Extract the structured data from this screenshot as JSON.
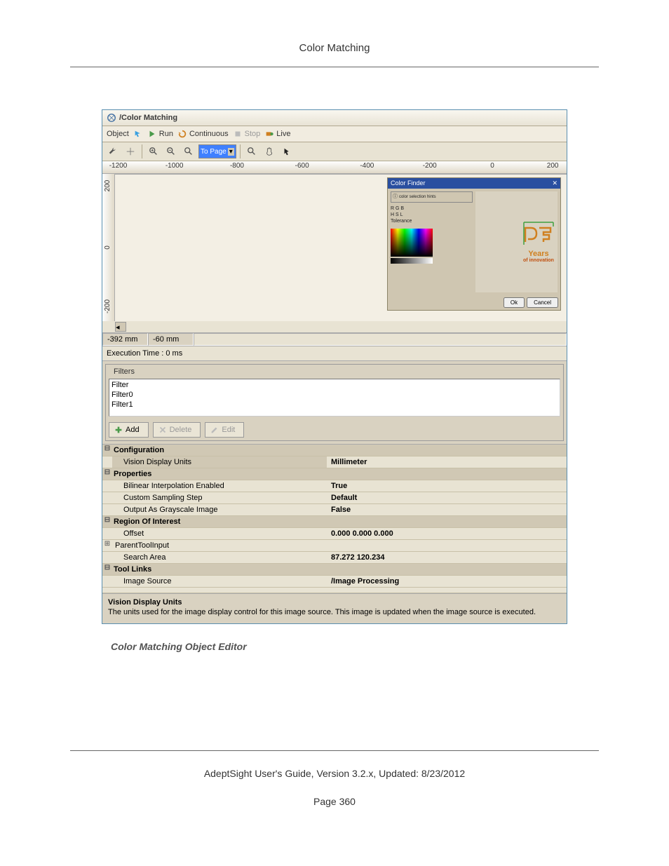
{
  "page": {
    "header": "Color Matching",
    "caption": "Color Matching Object Editor",
    "footer_text": "AdeptSight User's Guide,  Version 3.2.x, Updated: 8/23/2012",
    "page_number": "Page 360"
  },
  "window": {
    "title": "/Color Matching",
    "toolbar1": {
      "object": "Object",
      "run": "Run",
      "continuous": "Continuous",
      "stop": "Stop",
      "live": "Live"
    },
    "toolbar2": {
      "zoom_mode": "To Page"
    },
    "ruler_h": [
      "-1200",
      "-1000",
      "-800",
      "-600",
      "-400",
      "-200",
      "0",
      "200"
    ],
    "ruler_v": [
      "200",
      "0",
      "-200"
    ],
    "thumb": {
      "title": "Color Finder",
      "years": "Years",
      "sub": "of innovation",
      "ok": "Ok",
      "cancel": "Cancel"
    },
    "coords": {
      "x": "-392 mm",
      "y": "-60 mm"
    },
    "exec": "Execution Time : 0 ms",
    "filters": {
      "legend": "Filters",
      "items": [
        "Filter",
        "Filter0",
        "Filter1"
      ],
      "add": "Add",
      "delete": "Delete",
      "edit": "Edit"
    },
    "grid": {
      "configuration": "Configuration",
      "vision_display_units": "Vision Display Units",
      "vision_display_units_val": "Millimeter",
      "properties": "Properties",
      "bilinear": "Bilinear Interpolation Enabled",
      "bilinear_val": "True",
      "custom_step": "Custom Sampling Step",
      "custom_step_val": "Default",
      "grayscale": "Output As Grayscale Image",
      "grayscale_val": "False",
      "roi": "Region Of Interest",
      "offset": "Offset",
      "offset_val": "0.000 0.000 0.000",
      "parent_tool": "ParentToolInput",
      "search_area": "Search Area",
      "search_area_val": "87.272 120.234",
      "tool_links": "Tool Links",
      "image_source": "Image Source",
      "image_source_val": "/Image Processing"
    },
    "desc": {
      "title": "Vision Display Units",
      "text": "The units used for the image display control for this image source. This image is updated when the image source is executed."
    }
  }
}
